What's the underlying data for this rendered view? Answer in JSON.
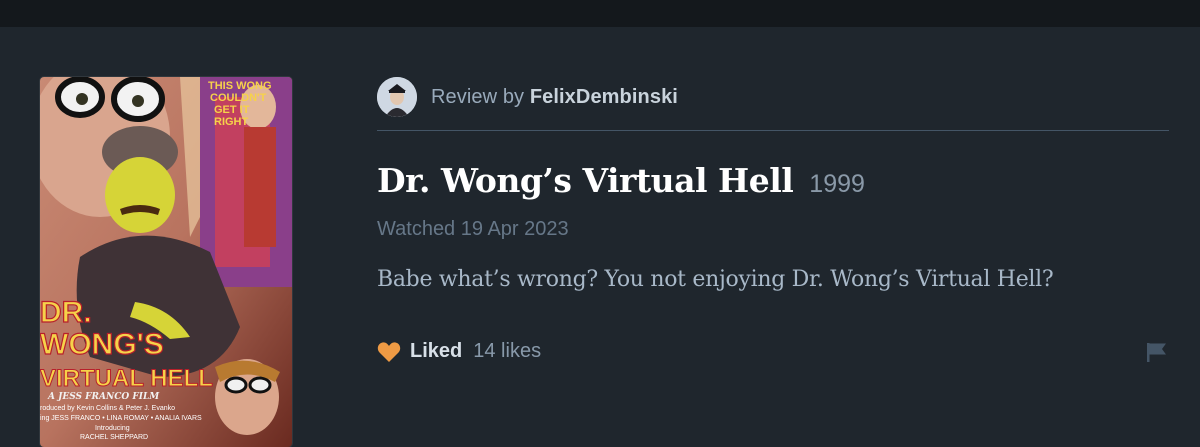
{
  "colors": {
    "page_background": "#1f262d",
    "top_bar": "#14181c",
    "heart": "#ee9a44",
    "divider": "#445566"
  },
  "poster": {
    "tagline_lines": [
      "THIS WONG",
      "COULDN'T",
      "GET IT",
      "RIGHT"
    ],
    "title_lines": [
      "DR.",
      "WONG'S",
      "VIRTUAL HELL"
    ],
    "credit_film": "A JESS FRANCO FILM",
    "credit_lines": [
      "roduced by Kevin Collins & Peter J. Evanko",
      "ing JESS FRANCO • LINA ROMAY • ANALIA IVARS",
      "Introducing",
      "RACHEL SHEPPARD"
    ]
  },
  "reviewer": {
    "prefix": "Review by",
    "username": "FelixDembinski",
    "avatar_icon": "avatar-icon"
  },
  "film": {
    "title": "Dr. Wong’s Virtual Hell",
    "year": "1999"
  },
  "watched": "Watched 19 Apr 2023",
  "review_text": "Babe what’s wrong? You not enjoying Dr. Wong’s Virtual Hell?",
  "actions": {
    "liked_icon": "heart-icon",
    "liked_label": "Liked",
    "likes_count": "14 likes",
    "report_icon": "flag-icon"
  }
}
